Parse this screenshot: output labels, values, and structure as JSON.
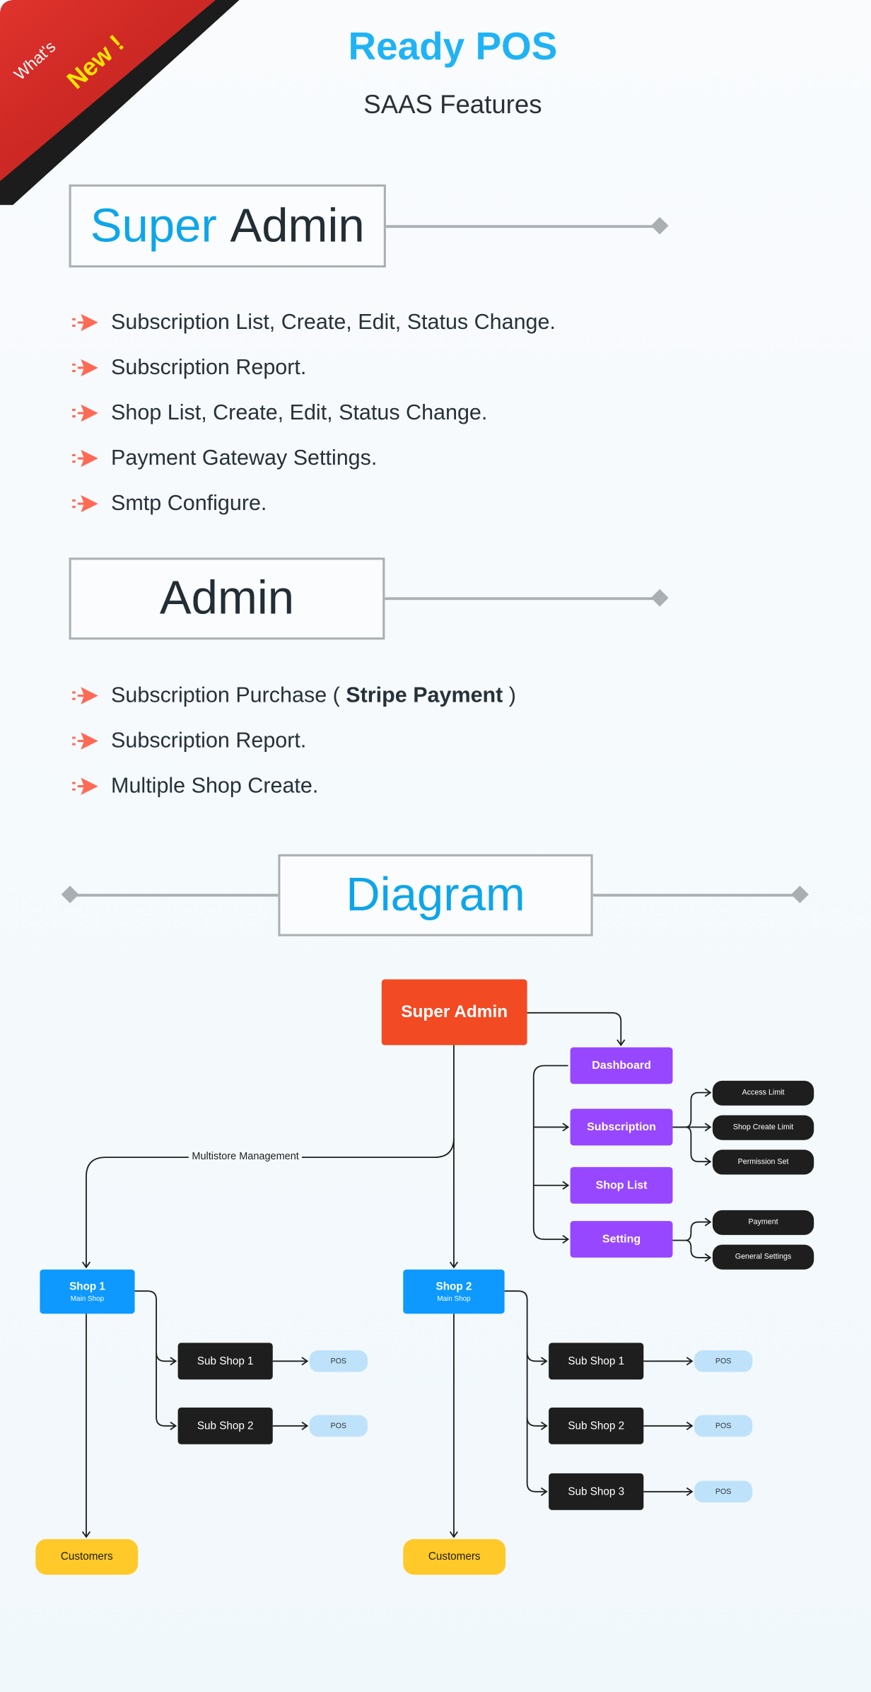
{
  "ribbon": {
    "line1": "What's",
    "line2": "New !"
  },
  "header": {
    "title": "Ready POS",
    "subtitle": "SAAS Features"
  },
  "sections": {
    "super_admin": {
      "title_highlight": "Super",
      "title_rest": "Admin",
      "items": [
        "Subscription List, Create, Edit, Status Change.",
        "Subscription Report.",
        "Shop List, Create, Edit, Status Change.",
        "Payment Gateway Settings.",
        "Smtp Configure."
      ]
    },
    "admin": {
      "title": "Admin",
      "items": [
        {
          "text": "Subscription Purchase ( ",
          "bold": "Stripe Payment",
          "after": " )"
        },
        {
          "text": "Subscription Report."
        },
        {
          "text": "Multiple Shop Create."
        }
      ]
    },
    "diagram": {
      "title": "Diagram"
    }
  },
  "diagram": {
    "root": "Super Admin",
    "menu": [
      "Dashboard",
      "Subscription",
      "Shop List",
      "Setting"
    ],
    "subscription_children": [
      "Access Limit",
      "Shop Create Limit",
      "Permission Set"
    ],
    "setting_children": [
      "Payment",
      "General Settings"
    ],
    "branch_label": "Multistore Management",
    "shops": [
      {
        "name": "Shop 1",
        "tag": "Main Shop",
        "subshops": [
          "Sub Shop 1",
          "Sub Shop 2"
        ],
        "terminal": "POS",
        "customers": "Customers"
      },
      {
        "name": "Shop 2",
        "tag": "Main Shop",
        "subshops": [
          "Sub Shop 1",
          "Sub Shop 2",
          "Sub Shop 3"
        ],
        "terminal": "POS",
        "customers": "Customers"
      }
    ]
  },
  "colors": {
    "brand": "#1fb3f5",
    "root": "#f24a23",
    "menu": "#9747ff",
    "shop": "#0d99ff",
    "customers": "#ffc929",
    "pos": "#bfe2fb",
    "bullet": "#ff6a55"
  }
}
